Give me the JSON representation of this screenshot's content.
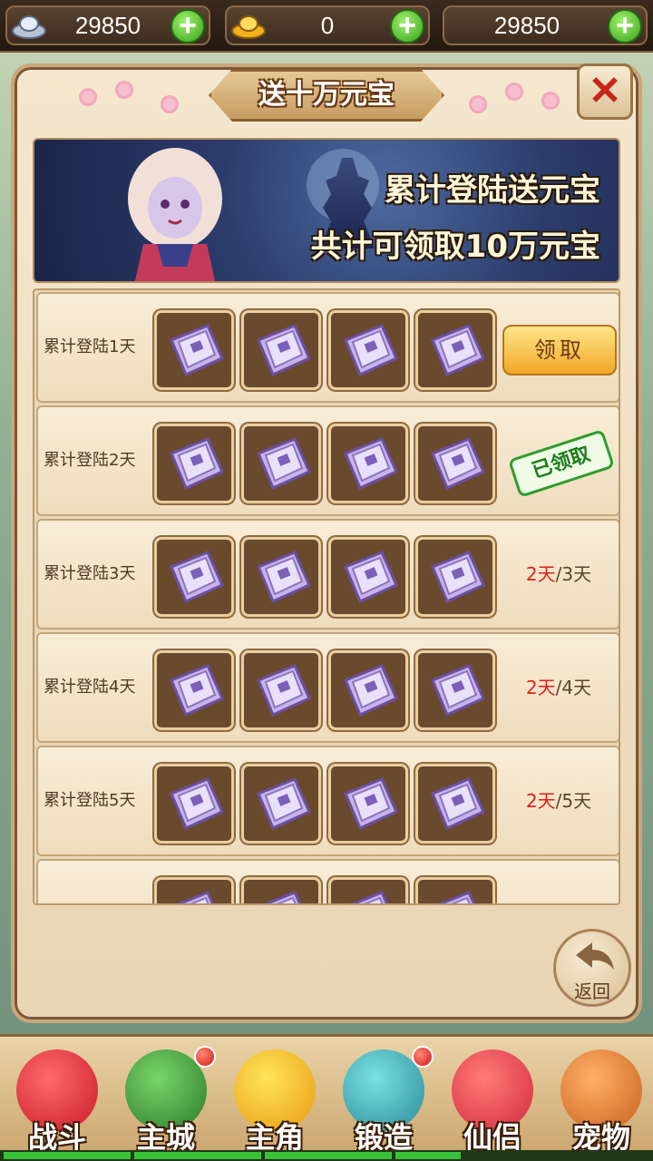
{
  "topbar": {
    "silver": {
      "value": "29850",
      "icon": "silver-ingot-icon"
    },
    "gold": {
      "value": "0",
      "icon": "gold-ingot-icon"
    },
    "third": {
      "value": "29850"
    }
  },
  "panel": {
    "title": "送十万元宝",
    "close_label": "✕",
    "banner_line1": "累计登陆送元宝",
    "banner_line2": "共计可领取10万元宝",
    "return_label": "返回"
  },
  "rewards": [
    {
      "label": "累计登陆1天",
      "status": "claim",
      "button": "领取"
    },
    {
      "label": "累计登陆2天",
      "status": "claimed",
      "stamp": "已领取"
    },
    {
      "label": "累计登陆3天",
      "status": "progress",
      "current": "2天",
      "total": "/3天"
    },
    {
      "label": "累计登陆4天",
      "status": "progress",
      "current": "2天",
      "total": "/4天"
    },
    {
      "label": "累计登陆5天",
      "status": "progress",
      "current": "2天",
      "total": "/5天"
    }
  ],
  "nav": [
    {
      "label": "战斗",
      "icon": "battle-icon",
      "badge": false
    },
    {
      "label": "主城",
      "icon": "main-city-icon",
      "badge": true
    },
    {
      "label": "主角",
      "icon": "hero-icon",
      "badge": false
    },
    {
      "label": "锻造",
      "icon": "forge-icon",
      "badge": true
    },
    {
      "label": "仙侣",
      "icon": "companion-icon",
      "badge": false
    },
    {
      "label": "宠物",
      "icon": "pet-icon",
      "badge": false
    }
  ],
  "colors": {
    "progress_current": "#e0201a",
    "claim_button": "#f0a826",
    "claimed_stamp": "#2f9c2f"
  }
}
